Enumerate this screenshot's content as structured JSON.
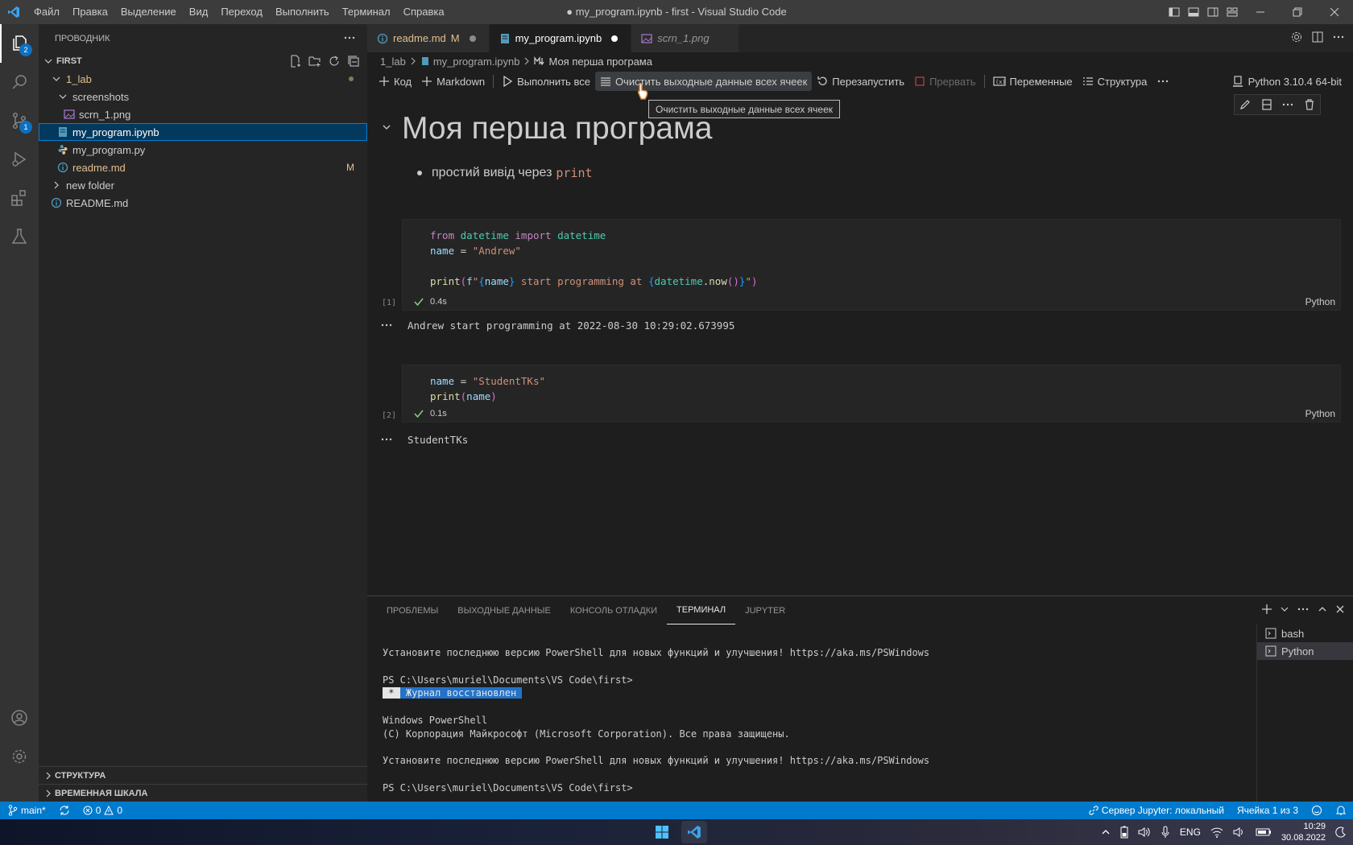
{
  "titlebar": {
    "menu": [
      "Файл",
      "Правка",
      "Выделение",
      "Вид",
      "Переход",
      "Выполнить",
      "Терминал",
      "Справка"
    ],
    "title": "● my_program.ipynb - first - Visual Studio Code"
  },
  "activity": {
    "explorer_badge": "2",
    "scm_badge": "1"
  },
  "explorer": {
    "header": "ПРОВОДНИК",
    "root": "FIRST",
    "tree": {
      "lab": "1_lab",
      "screenshots": "screenshots",
      "scrn": "scrn_1.png",
      "ipynb": "my_program.ipynb",
      "py": "my_program.py",
      "readme_lower": "readme.md",
      "readme_lower_status": "M",
      "new_folder": "new folder",
      "readme_upper": "README.md"
    },
    "outline": "СТРУКТУРА",
    "timeline": "ВРЕМЕННАЯ ШКАЛА"
  },
  "tabs": {
    "readme": "readme.md",
    "readme_status": "M",
    "notebook": "my_program.ipynb",
    "image": "scrn_1.png"
  },
  "breadcrumb": {
    "folder": "1_lab",
    "file": "my_program.ipynb",
    "symbol": "Моя перша програма"
  },
  "toolbar": {
    "code": "Код",
    "markdown": "Markdown",
    "run_all": "Выполнить все",
    "clear_outputs": "Очистить выходные данные всех ячеек",
    "restart": "Перезапустить",
    "interrupt": "Прервать",
    "variables": "Переменные",
    "outline": "Структура",
    "kernel": "Python 3.10.4 64-bit",
    "tooltip": "Очистить выходные данные всех ячеек"
  },
  "notebook": {
    "heading": "Моя перша програма",
    "bullet_text": "простий вивід через",
    "bullet_code": "print",
    "cell1": {
      "exec": "[1]",
      "time": "0.4s",
      "lang": "Python",
      "output": "Andrew start programming at 2022-08-30 10:29:02.673995"
    },
    "cell2": {
      "exec": "[2]",
      "time": "0.1s",
      "lang": "Python",
      "output": "StudentTKs"
    }
  },
  "panel": {
    "tabs": [
      "ПРОБЛЕМЫ",
      "ВЫХОДНЫЕ ДАННЫЕ",
      "КОНСОЛЬ ОТЛАДКИ",
      "ТЕРМИНАЛ",
      "JUPYTER"
    ],
    "terminal": {
      "line1": "Установите последнюю версию PowerShell для новых функций и улучшения! https://aka.ms/PSWindows",
      "line2": "PS C:\\Users\\muriel\\Documents\\VS Code\\first>",
      "restored_star": " * ",
      "restored_text": " Журнал восстановлен ",
      "line4": "Windows PowerShell",
      "line5": "(C) Корпорация Майкрософт (Microsoft Corporation). Все права защищены.",
      "line6": "Установите последнюю версию PowerShell для новых функций и улучшения! https://aka.ms/PSWindows",
      "line7": "PS C:\\Users\\muriel\\Documents\\VS Code\\first>"
    },
    "terminals": [
      "bash",
      "Python"
    ]
  },
  "statusbar": {
    "branch": "main*",
    "errors": "0",
    "warnings": "0",
    "jupyter": "Сервер Jupyter: локальный",
    "cell": "Ячейка 1 из 3"
  },
  "taskbar": {
    "lang": "ENG",
    "time": "10:29",
    "date": "30.08.2022"
  },
  "colors": {
    "accent": "#007acc",
    "selection": "#04395e",
    "modified": "#e2c08d"
  }
}
